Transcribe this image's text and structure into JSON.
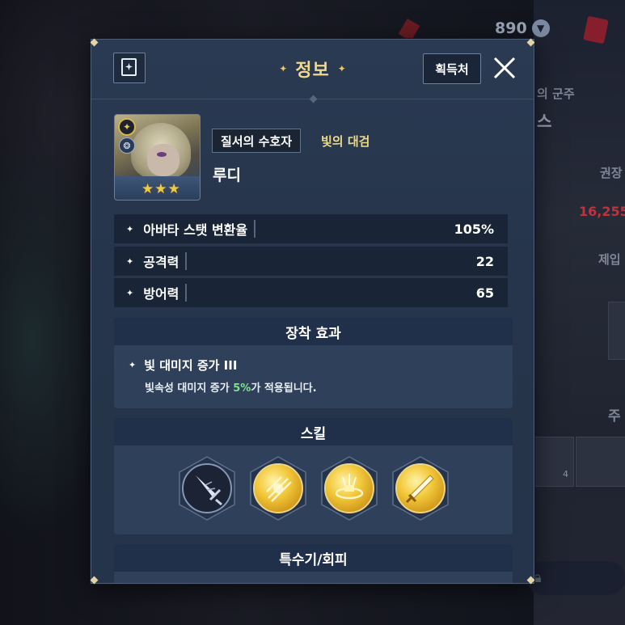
{
  "background": {
    "currency_value": "890",
    "lord_text": "의 군주",
    "name_fragment": "스",
    "recommend_fragment": "권장",
    "power_fragment": "16,255",
    "make_fragment": "제입",
    "main_fragment": "주",
    "slot_count": "4"
  },
  "dialog": {
    "title": "정보",
    "acquire_label": "획득처",
    "character": {
      "class_tag": "질서의 수호자",
      "weapon": "빛의 대검",
      "name": "루디",
      "star_count": 3
    },
    "stats": [
      {
        "label": "아바타 스탯 변환율",
        "value": "105%"
      },
      {
        "label": "공격력",
        "value": "22"
      },
      {
        "label": "방어력",
        "value": "65"
      }
    ],
    "equip_effect": {
      "header": "장착 효과",
      "name": "빛 대미지 증가 III",
      "desc_prefix": "빛속성 대미지 증가 ",
      "desc_value": "5%",
      "desc_suffix": "가 적용됩니다."
    },
    "skills": {
      "header": "스킬",
      "items": [
        {
          "icon": "sword-slash-icon",
          "style": "dark"
        },
        {
          "icon": "light-shard-icon",
          "style": "gold"
        },
        {
          "icon": "light-burst-icon",
          "style": "gold"
        },
        {
          "icon": "holy-blade-icon",
          "style": "gold"
        }
      ]
    },
    "special": {
      "header": "특수기/회피"
    }
  },
  "colors": {
    "title_gold": "#f0d98c",
    "weapon_gold": "#ecd98a",
    "percent_green": "#7fe08e",
    "panel": "#26354b"
  }
}
